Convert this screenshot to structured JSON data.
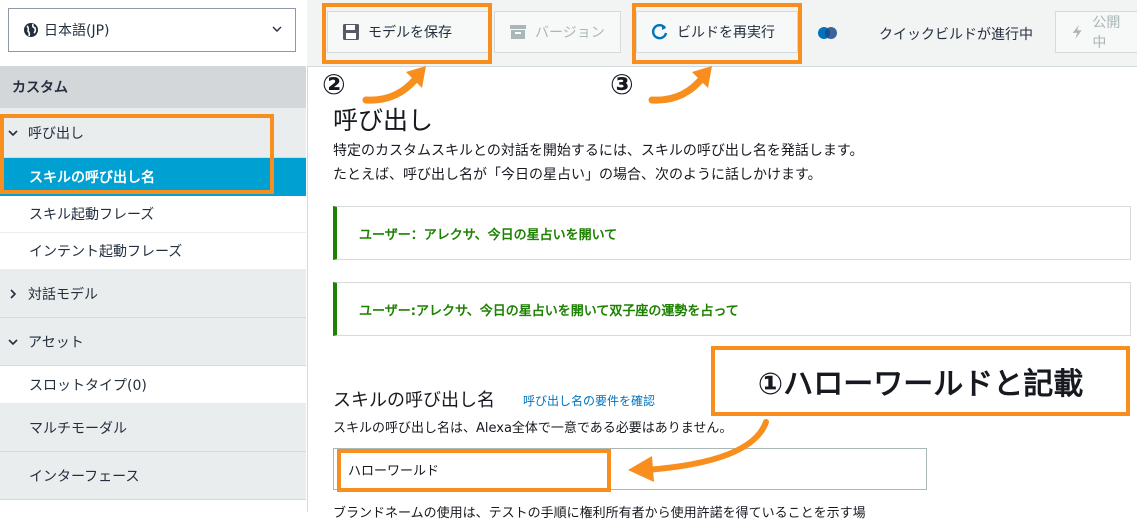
{
  "sidebar": {
    "locale": "日本語(JP)",
    "section_heading": "カスタム",
    "items": [
      {
        "label": "呼び出し"
      },
      {
        "label": "スキルの呼び出し名"
      },
      {
        "label": "スキル起動フレーズ"
      },
      {
        "label": "インテント起動フレーズ"
      },
      {
        "label": "対話モデル"
      },
      {
        "label": "アセット"
      },
      {
        "label": "スロットタイプ(0)"
      },
      {
        "label": "マルチモーダル"
      },
      {
        "label": "インターフェース"
      }
    ]
  },
  "toolbar": {
    "save_label": "モデルを保存",
    "version_label": "バージョン",
    "rebuild_label": "ビルドを再実行",
    "quick_build_status": "クイックビルドが進行中",
    "publish_label": "公開中"
  },
  "main": {
    "title": "呼び出し",
    "description_line1": "特定のカスタムスキルとの対話を開始するには、スキルの呼び出し名を発話します。",
    "description_line2": "たとえば、呼び出し名が「今日の星占い」の場合、次のように話しかけます。",
    "example1": "ユーザー：アレクサ、今日の星占いを開いて",
    "example2": "ユーザー:アレクサ、今日の星占いを開いて双子座の運勢を占って",
    "invocation_heading": "スキルの呼び出し名",
    "requirements_link": "呼び出し名の要件を確認",
    "help_text": "スキルの呼び出し名は、Alexa全体で一意である必要はありません。",
    "invocation_value": "ハローワールド",
    "footer_text": "ブランドネームの使用は、テストの手順に権利所有者から使用許諾を得ていることを示す場"
  },
  "annotations": {
    "step1": "①ハローワールドと記載",
    "step2": "②",
    "step3": "③",
    "accent_color": "#f78e1e"
  }
}
